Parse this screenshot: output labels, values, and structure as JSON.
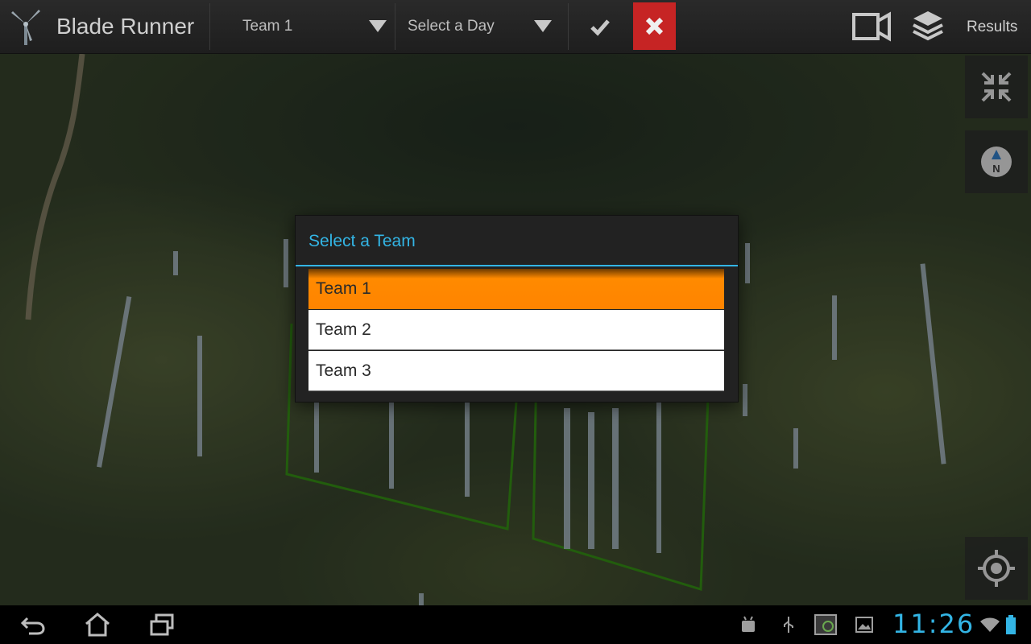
{
  "app": {
    "title": "Blade Runner",
    "logo_icon": "wind-turbine-icon"
  },
  "toolbar": {
    "team_spinner": {
      "value": "Team 1",
      "icon": "dropdown-triangle-icon"
    },
    "day_spinner": {
      "value": "Select a Day",
      "icon": "dropdown-triangle-icon"
    },
    "confirm_icon": "checkmark-icon",
    "cancel_icon": "close-x-icon",
    "cancel_color": "#c62424",
    "camera_icon": "video-camera-icon",
    "layers_icon": "layers-icon",
    "results_label": "Results"
  },
  "map": {
    "controls": [
      "collapse-arrows-icon",
      "compass-north-icon",
      "my-location-icon"
    ],
    "compass_label": "N",
    "boundary_color": "#2e7d12"
  },
  "dialog": {
    "title": "Select a Team",
    "accent_color": "#33b5e5",
    "selected_color": "#ff8400",
    "options": [
      {
        "label": "Team 1",
        "selected": true
      },
      {
        "label": "Team 2",
        "selected": false
      },
      {
        "label": "Team 3",
        "selected": false
      }
    ]
  },
  "system_bar": {
    "nav": [
      "back-icon",
      "home-icon",
      "recent-apps-icon"
    ],
    "status_icons": [
      "android-debug-icon",
      "usb-icon",
      "screenshot-app-icon",
      "gallery-icon",
      "wifi-icon",
      "battery-icon"
    ],
    "time": "11:26"
  }
}
